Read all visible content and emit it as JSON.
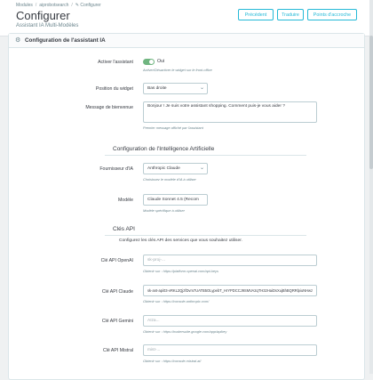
{
  "breadcrumb": [
    "Modules",
    "aiprobotsearch",
    "Configurer"
  ],
  "header": {
    "title": "Configurer",
    "subtitle": "Assistant IA Multi-Modèles"
  },
  "toolbar": {
    "back": "Précédent",
    "translate": "Traduire",
    "hooks": "Points d'accroche"
  },
  "panel": {
    "title": "Configuration de l'assistant IA"
  },
  "fields": {
    "enable": {
      "label": "Activer l'assistant",
      "value": "Oui",
      "help": "Activer/Désactiver le widget sur le front-office"
    },
    "position": {
      "label": "Position du widget",
      "value": "Bas droite"
    },
    "welcome": {
      "label": "Message de bienvenue",
      "value": "Bonjour ! Je suis votre assistant shopping. Comment puis-je vous aider ?",
      "help": "Premier message affiché par l'assistant"
    },
    "ai_section": "Configuration de l'Intelligence Artificielle",
    "provider": {
      "label": "Fournisseur d'IA",
      "value": "Anthropic Claude",
      "help": "Choisissez le modèle d'IA à utiliser"
    },
    "model": {
      "label": "Modèle",
      "value": "Claude Sonnet 4.5 (Recom",
      "help": "Modèle spécifique à utiliser"
    },
    "keys_section": "Clés API",
    "keys_intro": "Configurez les clés API des services que vous souhaitez utiliser.",
    "openai": {
      "label": "Clé API OpenAI",
      "placeholder": "sk-proj-...",
      "help": "Obtenir sur : https://platform.openai.com/api-keys"
    },
    "claude": {
      "label": "Clé API Claude",
      "value": "sk-ant-api03-vRKL2QjzfDvm7UATB5OLypebT_HrYPDCCJ9SMVA2qTH32HaiDsXujBhBQRRlpiuNHwz",
      "help": "Obtenir sur : https://console.anthropic.com/"
    },
    "gemini": {
      "label": "Clé API Gemini",
      "placeholder": "AIza...",
      "help": "Obtenir sur : https://makersuite.google.com/app/apikey"
    },
    "mistral": {
      "label": "Clé API Mistral",
      "placeholder": "mist-...",
      "help": "Obtenir sur : https://console.mistral.ai/"
    }
  }
}
